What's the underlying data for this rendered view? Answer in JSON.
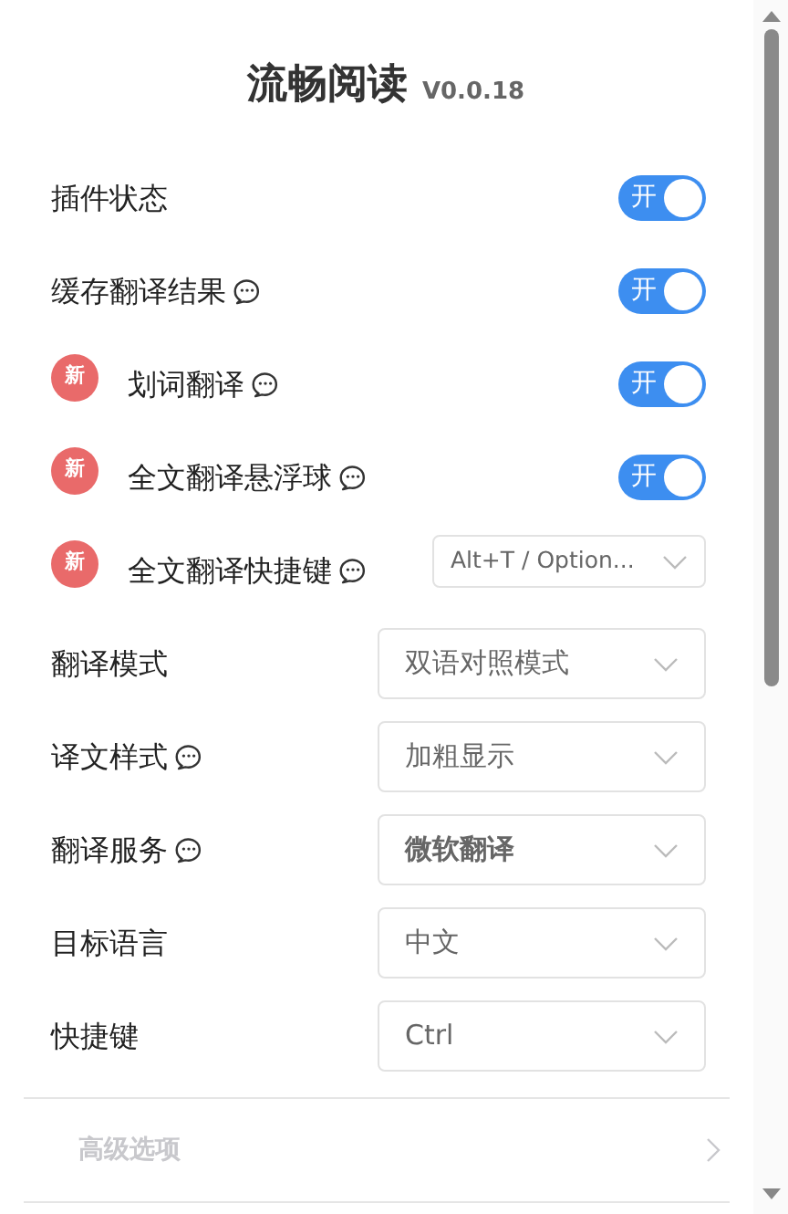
{
  "header": {
    "title": "流畅阅读",
    "version": "V0.0.18"
  },
  "settings": [
    {
      "kind": "toggle",
      "label": "插件状态",
      "is_new": false,
      "help": false,
      "on": true,
      "on_text": "开"
    },
    {
      "kind": "toggle",
      "label": "缓存翻译结果",
      "is_new": false,
      "help": true,
      "on": true,
      "on_text": "开"
    },
    {
      "kind": "toggle",
      "label": "划词翻译",
      "is_new": true,
      "new_badge": "新",
      "help": true,
      "on": true,
      "on_text": "开"
    },
    {
      "kind": "toggle",
      "label": "全文翻译悬浮球",
      "is_new": true,
      "new_badge": "新",
      "help": true,
      "on": true,
      "on_text": "开"
    },
    {
      "kind": "select",
      "label": "全文翻译快捷键",
      "is_new": true,
      "new_badge": "新",
      "help": true,
      "value": "Alt+T / Option...",
      "bold": false,
      "narrow": true
    },
    {
      "kind": "select",
      "label": "翻译模式",
      "is_new": false,
      "help": false,
      "value": "双语对照模式",
      "bold": false
    },
    {
      "kind": "select",
      "label": "译文样式",
      "is_new": false,
      "help": true,
      "value": "加粗显示",
      "bold": false
    },
    {
      "kind": "select",
      "label": "翻译服务",
      "is_new": false,
      "help": true,
      "value": "微软翻译",
      "bold": true
    },
    {
      "kind": "select",
      "label": "目标语言",
      "is_new": false,
      "help": false,
      "value": "中文",
      "bold": false
    },
    {
      "kind": "select",
      "label": "快捷键",
      "is_new": false,
      "help": false,
      "value": "Ctrl",
      "bold": false
    }
  ],
  "advanced": {
    "label": "高级选项"
  }
}
